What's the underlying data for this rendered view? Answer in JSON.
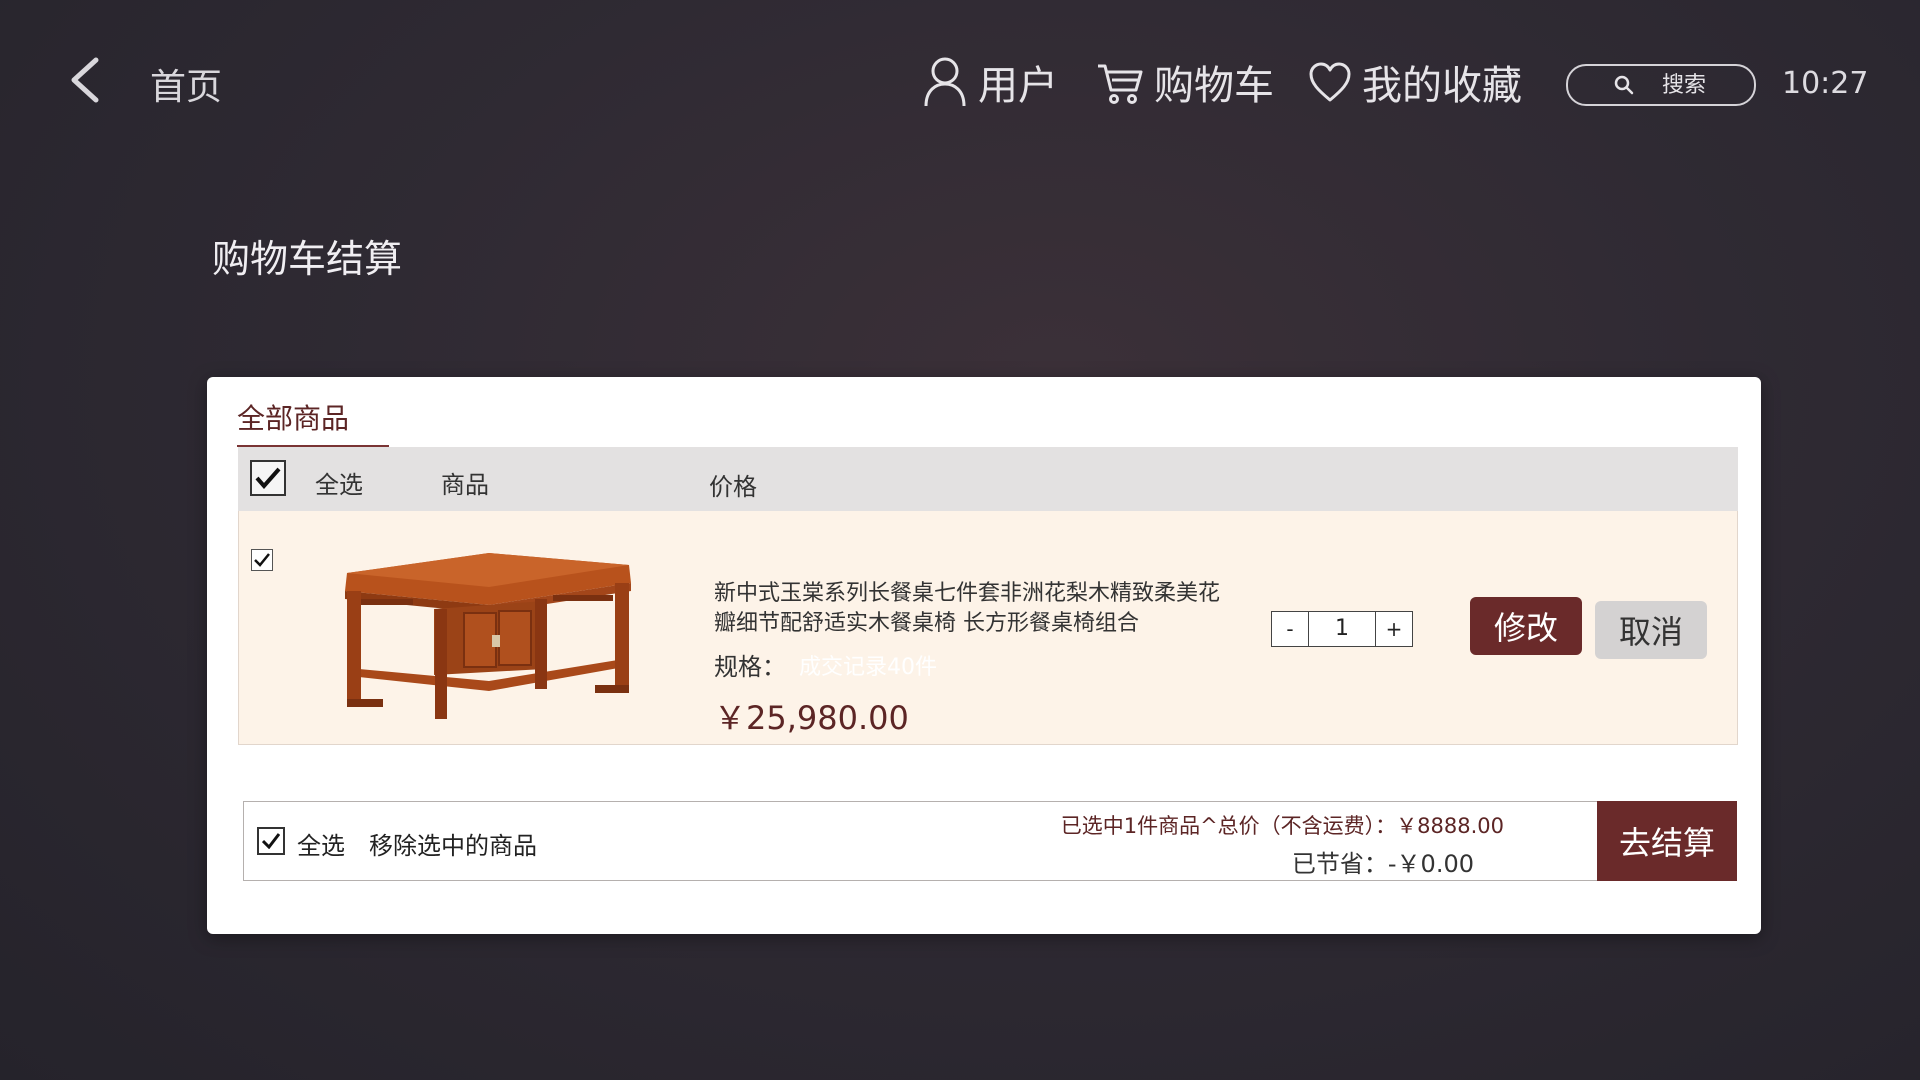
{
  "header": {
    "home_label": "首页",
    "nav": {
      "user": "用户",
      "cart": "购物车",
      "favorites": "我的收藏"
    },
    "search": {
      "placeholder": "搜索",
      "value": ""
    },
    "time": "10:27"
  },
  "page": {
    "title": "购物车结算"
  },
  "cart": {
    "tab_all": "全部商品",
    "columns": {
      "select_all": "全选",
      "product": "商品",
      "price": "价格"
    },
    "items": [
      {
        "name": "新中式玉棠系列长餐桌七件套非洲花梨木精致柔美花瓣细节配舒适实木餐桌椅 长方形餐桌椅组合",
        "spec_label": "规格：",
        "spec_value": "成交记录40件",
        "price": "￥25,980.00",
        "quantity": "1",
        "decrement": "-",
        "increment": "+",
        "edit_label": "修改",
        "cancel_label": "取消",
        "checked": true
      }
    ],
    "footer": {
      "select_all": "全选",
      "remove_selected": "移除选中的商品",
      "total": "已选中1件商品^总价（不含运费）：￥8888.00",
      "saved": "已节省：-￥0.00",
      "checkout": "去结算"
    }
  },
  "colors": {
    "accent": "#6a2a2a",
    "row_background": "#fdf3e8",
    "header_background": "#e3e1e1"
  }
}
